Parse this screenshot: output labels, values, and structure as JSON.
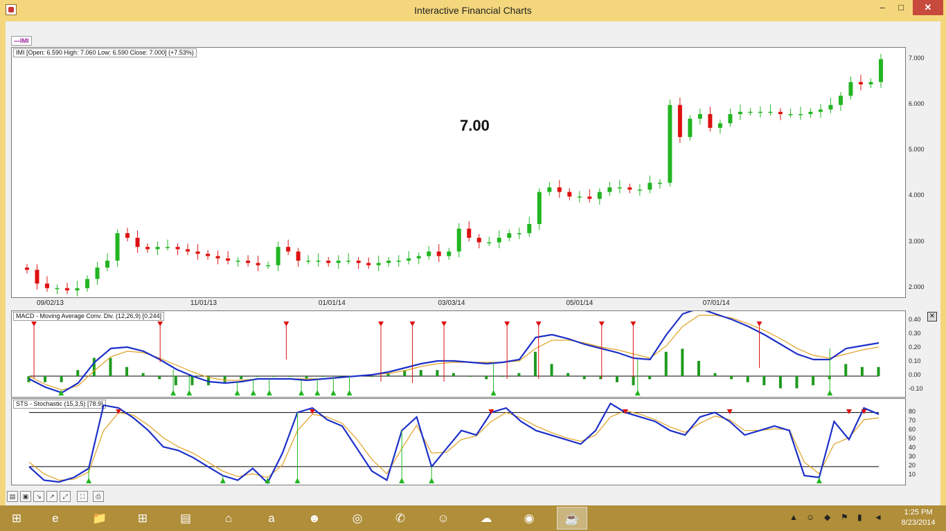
{
  "window": {
    "title": "Interactive Financial Charts",
    "minimize": "–",
    "maximize": "□",
    "close": "✕"
  },
  "symbol_tag": "—IMI",
  "big_price": "7.00",
  "price_panel": {
    "label": "IMI [Open: 6.590  High: 7.060  Low: 6.590  Close: 7.000] (+7.53%)",
    "y_ticks": [
      "7.000",
      "6.000",
      "5.000",
      "4.000",
      "3.000",
      "2.000"
    ],
    "x_ticks": [
      "09/02/13",
      "11/01/13",
      "01/01/14",
      "03/03/14",
      "05/01/14",
      "07/01/14"
    ]
  },
  "macd_panel": {
    "label": "MACD - Moving Average Conv. Div. (12,26,9) [0.244]",
    "y_ticks": [
      "0.40",
      "0.30",
      "0.20",
      "0.10",
      "0.00",
      "-0.10"
    ],
    "close": "✕"
  },
  "sts_panel": {
    "label": "STS - Stochastic (15,3,5) [78.9]",
    "y_ticks": [
      "80",
      "70",
      "60",
      "50",
      "40",
      "30",
      "20",
      "10"
    ]
  },
  "toolbar": [
    "open-icon",
    "save-icon",
    "zoom-in-icon",
    "zoom-out-icon",
    "zoom-reset-icon",
    "fit-icon",
    "print-icon"
  ],
  "taskbar": {
    "apps": [
      "start-icon",
      "internet-explorer-icon",
      "file-explorer-icon",
      "store-icon",
      "notes-icon",
      "home-icon",
      "amazon-icon",
      "mask-icon",
      "firefox-icon",
      "viber-icon",
      "yahoo-messenger-icon",
      "cloud-icon",
      "chrome-icon",
      "java-icon"
    ],
    "time": "1:25 PM",
    "date": "8/23/2014"
  },
  "colors": {
    "up": "#22b522",
    "down": "#dd1111",
    "macd_line": "#1c2fc8",
    "signal_line": "#e0a020",
    "titlebar": "#f4d77c",
    "close_button": "#c74a3c"
  },
  "chart_data": [
    {
      "type": "candlestick",
      "title": "IMI",
      "x_ticks": [
        "09/02/13",
        "11/01/13",
        "01/01/14",
        "03/03/14",
        "05/01/14",
        "07/01/14"
      ],
      "ylim": [
        1.8,
        7.25
      ],
      "y_ticks": [
        2,
        3,
        4,
        5,
        6,
        7
      ],
      "close_series": [
        2.4,
        2.1,
        2.0,
        2.0,
        1.95,
        2.0,
        2.2,
        2.45,
        2.6,
        3.2,
        3.1,
        2.9,
        2.85,
        2.9,
        2.9,
        2.85,
        2.8,
        2.75,
        2.7,
        2.65,
        2.6,
        2.6,
        2.55,
        2.5,
        2.5,
        2.9,
        2.8,
        2.6,
        2.6,
        2.6,
        2.55,
        2.6,
        2.6,
        2.55,
        2.5,
        2.55,
        2.6,
        2.6,
        2.65,
        2.7,
        2.8,
        2.7,
        2.8,
        3.3,
        3.1,
        3.0,
        3.0,
        3.1,
        3.2,
        3.2,
        3.4,
        4.1,
        4.2,
        4.1,
        4.0,
        4.0,
        3.95,
        4.1,
        4.2,
        4.2,
        4.15,
        4.15,
        4.3,
        4.3,
        6.0,
        5.3,
        5.7,
        5.8,
        5.5,
        5.6,
        5.8,
        5.85,
        5.85,
        5.85,
        5.85,
        5.8,
        5.8,
        5.8,
        5.85,
        5.9,
        6.0,
        6.2,
        6.5,
        6.45,
        6.5,
        7.0
      ],
      "ylabel": "",
      "xlabel": ""
    },
    {
      "type": "line",
      "title": "MACD - Moving Average Conv. Div. (12,26,9) [0.244]",
      "ylim": [
        -0.15,
        0.47
      ],
      "y_ticks": [
        -0.1,
        0.0,
        0.1,
        0.2,
        0.3,
        0.4
      ],
      "series": [
        {
          "values": [
            -0.02,
            -0.08,
            -0.12,
            -0.05,
            0.1,
            0.2,
            0.21,
            0.18,
            0.12,
            0.05,
            0.0,
            -0.04,
            -0.05,
            -0.04,
            -0.02,
            -0.02,
            -0.02,
            -0.03,
            -0.02,
            -0.01,
            0.0,
            0.01,
            0.03,
            0.06,
            0.09,
            0.11,
            0.11,
            0.1,
            0.09,
            0.1,
            0.12,
            0.28,
            0.3,
            0.27,
            0.23,
            0.2,
            0.17,
            0.13,
            0.12,
            0.3,
            0.45,
            0.49,
            0.45,
            0.41,
            0.36,
            0.3,
            0.23,
            0.16,
            0.12,
            0.12,
            0.2,
            0.22,
            0.24
          ]
        },
        {
          "values": [
            0.0,
            -0.06,
            -0.1,
            -0.07,
            0.04,
            0.14,
            0.18,
            0.17,
            0.13,
            0.08,
            0.03,
            -0.01,
            -0.03,
            -0.03,
            -0.02,
            -0.02,
            -0.02,
            -0.02,
            -0.02,
            -0.01,
            0.0,
            0.01,
            0.02,
            0.04,
            0.07,
            0.09,
            0.1,
            0.1,
            0.1,
            0.1,
            0.11,
            0.2,
            0.26,
            0.26,
            0.24,
            0.21,
            0.19,
            0.16,
            0.13,
            0.22,
            0.36,
            0.44,
            0.44,
            0.42,
            0.38,
            0.33,
            0.27,
            0.2,
            0.15,
            0.13,
            0.16,
            0.19,
            0.21
          ]
        }
      ]
    },
    {
      "type": "line",
      "title": "STS - Stochastic (15,3,5) [78.9]",
      "ylim": [
        0,
        95
      ],
      "y_ticks": [
        10,
        20,
        30,
        40,
        50,
        60,
        70,
        80
      ],
      "series": [
        {
          "values": [
            20,
            5,
            3,
            8,
            18,
            88,
            85,
            74,
            60,
            42,
            38,
            30,
            20,
            10,
            5,
            18,
            2,
            35,
            80,
            85,
            72,
            65,
            40,
            15,
            5,
            60,
            75,
            20,
            40,
            60,
            55,
            80,
            85,
            70,
            60,
            55,
            50,
            45,
            60,
            90,
            80,
            75,
            70,
            60,
            55,
            75,
            80,
            70,
            55,
            60,
            65,
            60,
            10,
            8,
            70,
            50,
            85,
            78
          ]
        },
        {
          "values": [
            25,
            12,
            5,
            6,
            14,
            60,
            80,
            77,
            66,
            52,
            42,
            35,
            25,
            15,
            9,
            12,
            8,
            22,
            60,
            78,
            75,
            68,
            50,
            28,
            12,
            40,
            66,
            35,
            36,
            50,
            54,
            70,
            80,
            74,
            65,
            58,
            52,
            48,
            55,
            75,
            82,
            78,
            72,
            64,
            58,
            68,
            76,
            72,
            60,
            60,
            62,
            61,
            25,
            12,
            45,
            52,
            72,
            74
          ]
        }
      ]
    }
  ]
}
